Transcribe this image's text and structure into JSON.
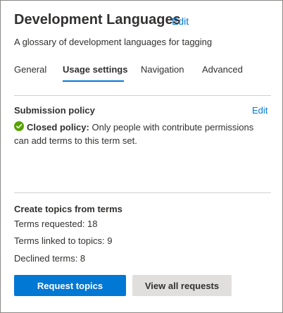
{
  "header": {
    "title": "Development Languages",
    "edit_label": "Edit",
    "subtitle": "A glossary of development languages for tagging"
  },
  "tabs": [
    {
      "label": "General",
      "active": false
    },
    {
      "label": "Usage settings",
      "active": true
    },
    {
      "label": "Navigation",
      "active": false
    },
    {
      "label": "Advanced",
      "active": false
    }
  ],
  "submission_policy": {
    "title": "Submission policy",
    "edit_label": "Edit",
    "status_icon": "check-circle-icon",
    "status_color": "#57a300",
    "policy_name": "Closed policy:",
    "policy_description": " Only people with contribute permissions can add terms to this term set."
  },
  "topics": {
    "title": "Create topics from terms",
    "terms_requested": "Terms requested: 18",
    "terms_linked": "Terms linked to topics: 9",
    "declined_terms": "Declined terms: 8"
  },
  "actions": {
    "request_topics_label": "Request topics",
    "view_all_requests_label": "View all requests"
  },
  "colors": {
    "accent": "#0078d4",
    "secondary_button": "#e1dfdd",
    "divider": "#d2d0ce"
  }
}
